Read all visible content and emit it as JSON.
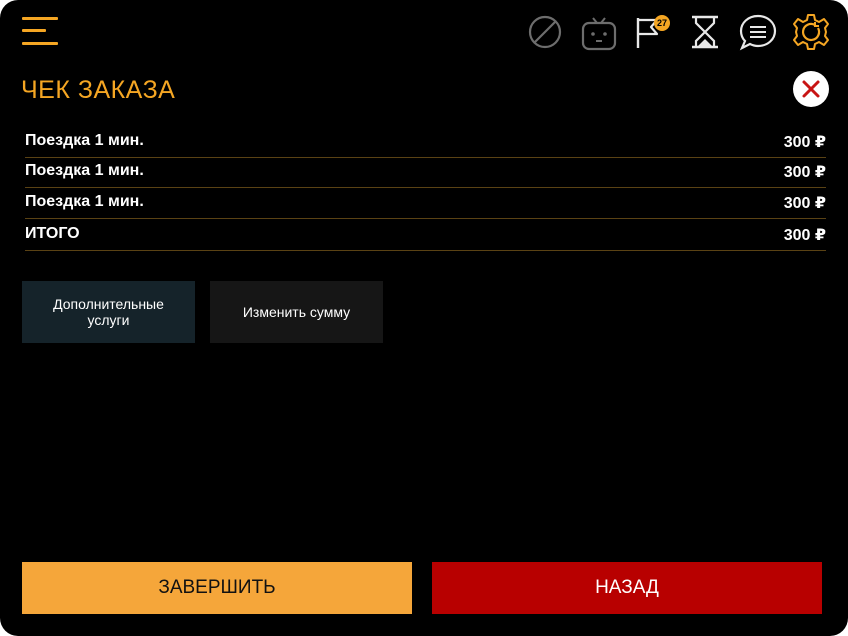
{
  "colors": {
    "accent": "#f5a623",
    "danger": "#b80000",
    "background": "#000000"
  },
  "toolbar": {
    "icons": [
      "block-icon",
      "robot-icon",
      "flag-icon",
      "hourglass-icon",
      "chat-icon",
      "settings-icon"
    ],
    "flag_badge": "27"
  },
  "header": {
    "title": "ЧЕК ЗАКАЗА"
  },
  "receipt": {
    "items": [
      {
        "name": "Поездка 1 мин.",
        "price": "300 ₽"
      },
      {
        "name": "Поездка 1 мин.",
        "price": "300 ₽"
      },
      {
        "name": "Поездка 1 мин.",
        "price": "300 ₽"
      }
    ],
    "total": {
      "label": "ИТОГО",
      "price": "300 ₽"
    }
  },
  "actions": {
    "extra_line1": "Дополнительные",
    "extra_line2": "услуги",
    "change_amount": "Изменить сумму"
  },
  "footer": {
    "finish": "ЗАВЕРШИТЬ",
    "back": "НАЗАД"
  }
}
